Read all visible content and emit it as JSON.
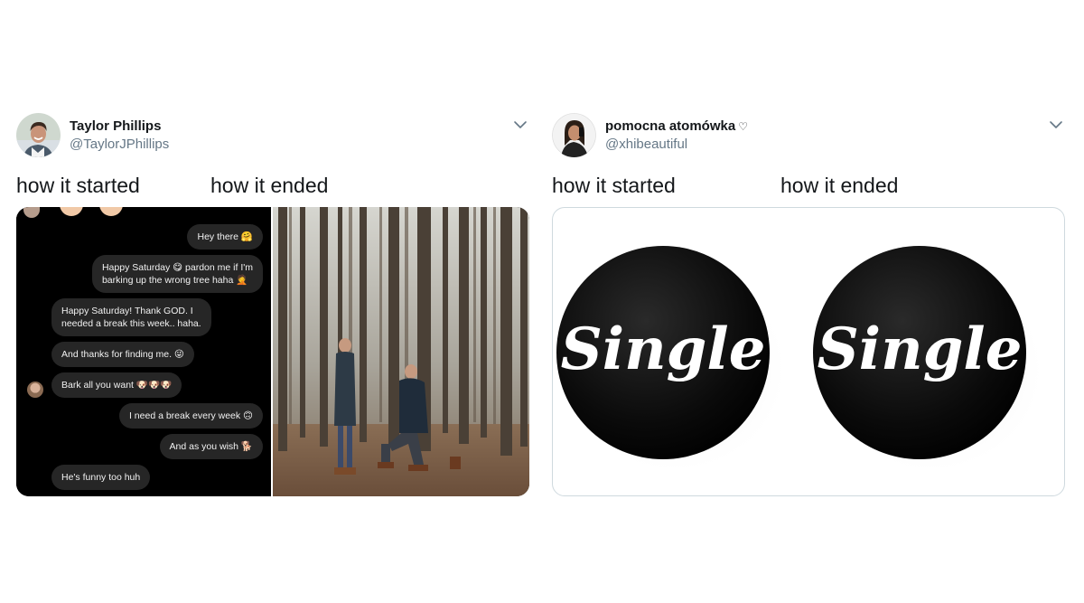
{
  "tweets": [
    {
      "display_name": "Taylor Phillips",
      "handle": "@TaylorJPhillips",
      "caption_left": "how it started",
      "caption_right": "how it ended",
      "chat": {
        "messages": [
          {
            "side": "right",
            "text": "Hey there 🤗"
          },
          {
            "side": "right",
            "text": "Happy Saturday 😋 pardon me if I'm\nbarking up the wrong tree haha 🤦"
          },
          {
            "side": "left",
            "text": "Happy Saturday! Thank GOD. I\nneeded a break this week.. haha."
          },
          {
            "side": "left",
            "text": "And thanks for finding me. 😜"
          },
          {
            "side": "left",
            "text": "Bark all you want 🐶🐶🐶"
          },
          {
            "side": "right",
            "text": "I need a break every week 🙃"
          },
          {
            "side": "right",
            "text": "And as you wish 🐕"
          },
          {
            "side": "left",
            "text": "He's funny too huh"
          }
        ]
      }
    },
    {
      "display_name": "pomocna atomówka",
      "name_suffix": "♡",
      "handle": "@xhibeautiful",
      "caption_left": "how it started",
      "caption_right": "how it ended",
      "button_text_left": "Single",
      "button_text_right": "Single"
    }
  ],
  "icons": {
    "menu": "chevron-down-icon"
  },
  "colors": {
    "handle": "#657786",
    "text": "#14171a",
    "bubble": "#262626",
    "border": "#cfd9de"
  }
}
